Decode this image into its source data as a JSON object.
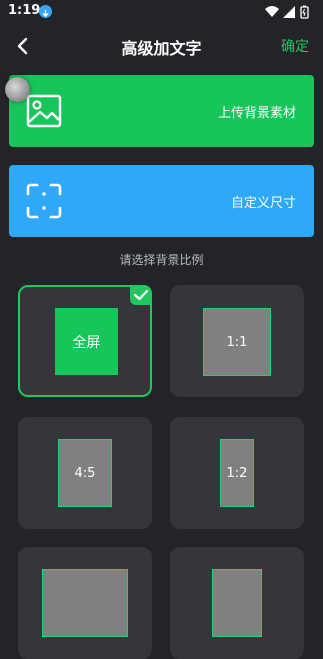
{
  "status_bar": {
    "time": "1:19",
    "icons": [
      "download-badge-icon",
      "wifi-icon",
      "cellular-signal-icon",
      "battery-icon"
    ]
  },
  "header": {
    "title": "高级加文字",
    "confirm_label": "确定"
  },
  "cards": {
    "upload_label": "上传背景素材",
    "custom_size_label": "自定义尺寸"
  },
  "section": {
    "ratio_title": "请选择背景比例"
  },
  "ratios": [
    {
      "label": "全屏",
      "selected": true
    },
    {
      "label": "1:1",
      "selected": false
    },
    {
      "label": "4:5",
      "selected": false
    },
    {
      "label": "1:2",
      "selected": false
    },
    {
      "label": "",
      "selected": false
    },
    {
      "label": "",
      "selected": false
    }
  ],
  "colors": {
    "background": "#222428",
    "accent_green": "#22c55e",
    "upload_card": "#18c55b",
    "custom_card": "#2fa9f7",
    "tile_bg": "#34363c"
  }
}
